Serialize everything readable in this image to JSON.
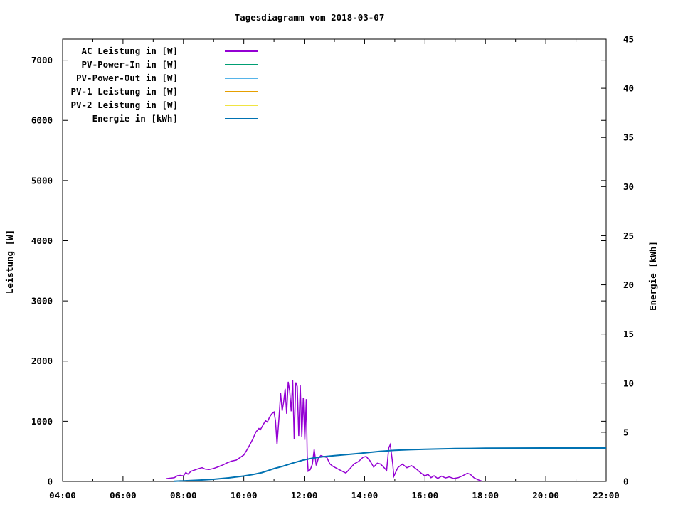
{
  "window": {
    "background": "#ffffff",
    "text_color": "#000000"
  },
  "chart_data": {
    "type": "line",
    "title": "Tagesdiagramm vom 2018-03-07",
    "xlabel": "",
    "ylabel": "Leistung [W]",
    "y2label": "Energie [kWh]",
    "xlim": [
      4,
      22
    ],
    "ylim": [
      0,
      7350
    ],
    "y2lim": [
      0,
      45
    ],
    "grid": "off",
    "legend_position": "top-left-inside",
    "x_major_ticks": [
      {
        "t": 4,
        "label": "04:00"
      },
      {
        "t": 6,
        "label": "06:00"
      },
      {
        "t": 8,
        "label": "08:00"
      },
      {
        "t": 10,
        "label": "10:00"
      },
      {
        "t": 12,
        "label": "12:00"
      },
      {
        "t": 14,
        "label": "14:00"
      },
      {
        "t": 16,
        "label": "16:00"
      },
      {
        "t": 18,
        "label": "18:00"
      },
      {
        "t": 20,
        "label": "20:00"
      },
      {
        "t": 22,
        "label": "22:00"
      }
    ],
    "x_minor_step_hours": 1,
    "y_ticks": [
      0,
      1000,
      2000,
      3000,
      4000,
      5000,
      6000,
      7000
    ],
    "y2_ticks": [
      0,
      5,
      10,
      15,
      20,
      25,
      30,
      35,
      40,
      45
    ],
    "series": [
      {
        "name": "AC Leistung in [W]",
        "color": "#9400d3",
        "axis": "left",
        "width": 1.5,
        "points": [
          [
            7.42,
            45
          ],
          [
            7.5,
            50
          ],
          [
            7.6,
            55
          ],
          [
            7.7,
            62
          ],
          [
            7.8,
            95
          ],
          [
            7.9,
            100
          ],
          [
            8.0,
            92
          ],
          [
            8.08,
            148
          ],
          [
            8.15,
            120
          ],
          [
            8.25,
            168
          ],
          [
            8.35,
            185
          ],
          [
            8.5,
            212
          ],
          [
            8.62,
            228
          ],
          [
            8.72,
            205
          ],
          [
            8.85,
            198
          ],
          [
            9.0,
            215
          ],
          [
            9.15,
            242
          ],
          [
            9.3,
            272
          ],
          [
            9.45,
            310
          ],
          [
            9.6,
            338
          ],
          [
            9.75,
            355
          ],
          [
            9.9,
            405
          ],
          [
            10.0,
            440
          ],
          [
            10.1,
            520
          ],
          [
            10.2,
            610
          ],
          [
            10.3,
            705
          ],
          [
            10.4,
            820
          ],
          [
            10.5,
            880
          ],
          [
            10.55,
            860
          ],
          [
            10.65,
            950
          ],
          [
            10.72,
            1010
          ],
          [
            10.78,
            985
          ],
          [
            10.85,
            1065
          ],
          [
            10.92,
            1120
          ],
          [
            11.0,
            1155
          ],
          [
            11.05,
            1010
          ],
          [
            11.1,
            615
          ],
          [
            11.17,
            1085
          ],
          [
            11.22,
            1465
          ],
          [
            11.27,
            1175
          ],
          [
            11.32,
            1320
          ],
          [
            11.37,
            1540
          ],
          [
            11.42,
            1125
          ],
          [
            11.47,
            1655
          ],
          [
            11.52,
            1500
          ],
          [
            11.57,
            1165
          ],
          [
            11.62,
            1690
          ],
          [
            11.67,
            705
          ],
          [
            11.72,
            1645
          ],
          [
            11.77,
            1580
          ],
          [
            11.82,
            755
          ],
          [
            11.87,
            1605
          ],
          [
            11.92,
            735
          ],
          [
            11.97,
            1385
          ],
          [
            12.02,
            690
          ],
          [
            12.07,
            1370
          ],
          [
            12.1,
            430
          ],
          [
            12.13,
            170
          ],
          [
            12.2,
            195
          ],
          [
            12.27,
            285
          ],
          [
            12.33,
            530
          ],
          [
            12.4,
            265
          ],
          [
            12.47,
            385
          ],
          [
            12.55,
            430
          ],
          [
            12.65,
            412
          ],
          [
            12.75,
            398
          ],
          [
            12.85,
            292
          ],
          [
            12.95,
            252
          ],
          [
            13.1,
            212
          ],
          [
            13.25,
            172
          ],
          [
            13.38,
            140
          ],
          [
            13.5,
            205
          ],
          [
            13.65,
            290
          ],
          [
            13.8,
            332
          ],
          [
            13.95,
            402
          ],
          [
            14.05,
            415
          ],
          [
            14.18,
            342
          ],
          [
            14.3,
            238
          ],
          [
            14.42,
            302
          ],
          [
            14.53,
            288
          ],
          [
            14.65,
            228
          ],
          [
            14.73,
            182
          ],
          [
            14.8,
            558
          ],
          [
            14.85,
            612
          ],
          [
            14.93,
            302
          ],
          [
            14.97,
            88
          ],
          [
            15.1,
            228
          ],
          [
            15.25,
            288
          ],
          [
            15.4,
            228
          ],
          [
            15.55,
            262
          ],
          [
            15.63,
            238
          ],
          [
            15.75,
            192
          ],
          [
            15.88,
            135
          ],
          [
            16.0,
            92
          ],
          [
            16.1,
            118
          ],
          [
            16.2,
            62
          ],
          [
            16.3,
            95
          ],
          [
            16.42,
            48
          ],
          [
            16.55,
            88
          ],
          [
            16.68,
            58
          ],
          [
            16.8,
            75
          ],
          [
            16.95,
            48
          ],
          [
            17.1,
            62
          ],
          [
            17.25,
            95
          ],
          [
            17.4,
            135
          ],
          [
            17.5,
            118
          ],
          [
            17.62,
            62
          ],
          [
            17.75,
            28
          ],
          [
            17.88,
            5
          ]
        ]
      },
      {
        "name": "PV-Power-In in [W]",
        "color": "#009e73",
        "axis": "left",
        "width": 1.5,
        "points": []
      },
      {
        "name": "PV-Power-Out in [W]",
        "color": "#56b4e9",
        "axis": "left",
        "width": 1.5,
        "points": []
      },
      {
        "name": "PV-1 Leistung in [W]",
        "color": "#e69f00",
        "axis": "left",
        "width": 1.5,
        "points": []
      },
      {
        "name": "PV-2 Leistung in [W]",
        "color": "#f0e442",
        "axis": "left",
        "width": 1.5,
        "points": []
      },
      {
        "name": "Energie in [kWh]",
        "color": "#0072b2",
        "axis": "right",
        "width": 2,
        "points": [
          [
            7.7,
            0.02
          ],
          [
            8.0,
            0.06
          ],
          [
            8.5,
            0.13
          ],
          [
            9.0,
            0.22
          ],
          [
            9.5,
            0.36
          ],
          [
            10.0,
            0.55
          ],
          [
            10.3,
            0.7
          ],
          [
            10.6,
            0.9
          ],
          [
            11.0,
            1.3
          ],
          [
            11.3,
            1.55
          ],
          [
            11.6,
            1.85
          ],
          [
            12.0,
            2.2
          ],
          [
            12.3,
            2.38
          ],
          [
            12.6,
            2.5
          ],
          [
            13.0,
            2.62
          ],
          [
            13.5,
            2.76
          ],
          [
            14.0,
            2.9
          ],
          [
            14.5,
            3.05
          ],
          [
            15.0,
            3.16
          ],
          [
            15.5,
            3.23
          ],
          [
            16.0,
            3.28
          ],
          [
            16.5,
            3.31
          ],
          [
            17.0,
            3.34
          ],
          [
            17.5,
            3.36
          ],
          [
            18.0,
            3.38
          ],
          [
            19.0,
            3.39
          ],
          [
            20.0,
            3.4
          ],
          [
            21.0,
            3.4
          ],
          [
            22.0,
            3.4
          ]
        ]
      }
    ]
  }
}
